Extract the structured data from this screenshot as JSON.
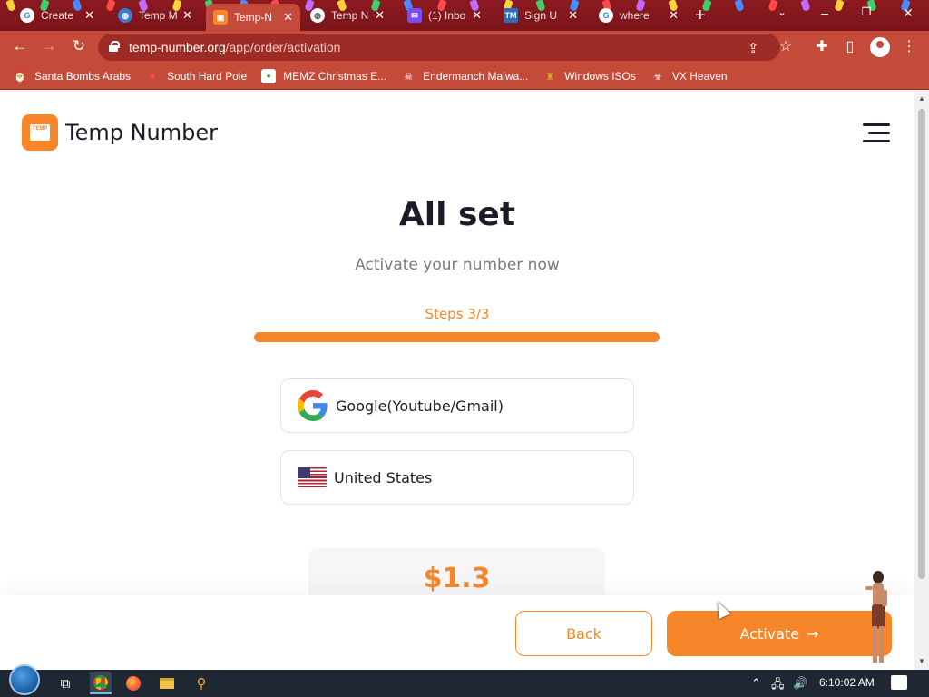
{
  "tabs": [
    {
      "title": "Create",
      "favicon": "google-g",
      "favicon_color": "#fff"
    },
    {
      "title": "Temp M",
      "favicon": "globe",
      "favicon_color": "#3a7bd5"
    },
    {
      "title": "Temp-N",
      "favicon": "temp-number",
      "favicon_color": "#f7862a",
      "active": true
    },
    {
      "title": "Temp N",
      "favicon": "globe",
      "favicon_color": "#fff"
    },
    {
      "title": "(1) Inbo",
      "favicon": "inbox",
      "favicon_color": "#7b4cff"
    },
    {
      "title": "Sign U",
      "favicon": "tm",
      "favicon_color": "#2a6ebb"
    },
    {
      "title": "where",
      "favicon": "google-g",
      "favicon_color": "#fff"
    }
  ],
  "toolbar": {
    "url_host": "temp-number.org",
    "url_path": "/app/order/activation"
  },
  "bookmarks": [
    {
      "label": "Santa Bombs Arabs",
      "icon": "santa-icon"
    },
    {
      "label": "South Hard Pole",
      "icon": "star-icon"
    },
    {
      "label": "MEMZ Christmas E...",
      "icon": "memz-icon"
    },
    {
      "label": "Endermanch Malwa...",
      "icon": "skull-icon"
    },
    {
      "label": "Windows ISOs",
      "icon": "trophy-icon"
    },
    {
      "label": "VX Heaven",
      "icon": "biohazard-icon"
    }
  ],
  "site": {
    "brand": "Temp Number",
    "logo_text": "TEMP"
  },
  "main": {
    "title": "All set",
    "subtitle": "Activate your number now",
    "steps_label": "Steps 3/3",
    "progress": 1.0,
    "service": "Google(Youtube/Gmail)",
    "country": "United States",
    "price": "$1.3"
  },
  "actions": {
    "back_label": "Back",
    "activate_label": "Activate"
  },
  "taskbar": {
    "clock": "6:10:02 AM"
  },
  "colors": {
    "accent": "#f7862a",
    "browser_frame": "#c44a3a"
  }
}
